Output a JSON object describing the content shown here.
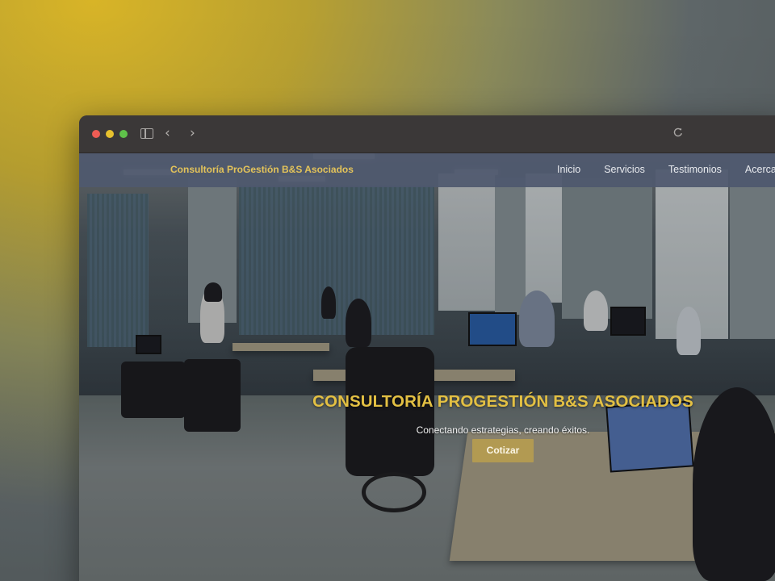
{
  "site": {
    "brand": "Consultoría ProGestión B&S Asociados",
    "nav": [
      {
        "label": "Inicio"
      },
      {
        "label": "Servicios"
      },
      {
        "label": "Testimonios"
      },
      {
        "label": "Acerca"
      }
    ]
  },
  "hero": {
    "title": "CONSULTORÍA PROGESTIÓN B&S ASOCIADOS",
    "subtitle": "Conectando estrategias, creando éxitos.",
    "cta_label": "Cotizar",
    "background_image": "office-photo"
  },
  "browser": {
    "icons": [
      "close-dot-icon",
      "minimize-dot-icon",
      "zoom-dot-icon",
      "sidebar-icon",
      "back-arrow-icon",
      "forward-arrow-icon",
      "reload-icon"
    ]
  },
  "colors": {
    "brand_gold": "#e3c043",
    "cta_bg": "#b29a52",
    "header_bg": "#4e586e",
    "titlebar_bg": "#3b3838"
  }
}
